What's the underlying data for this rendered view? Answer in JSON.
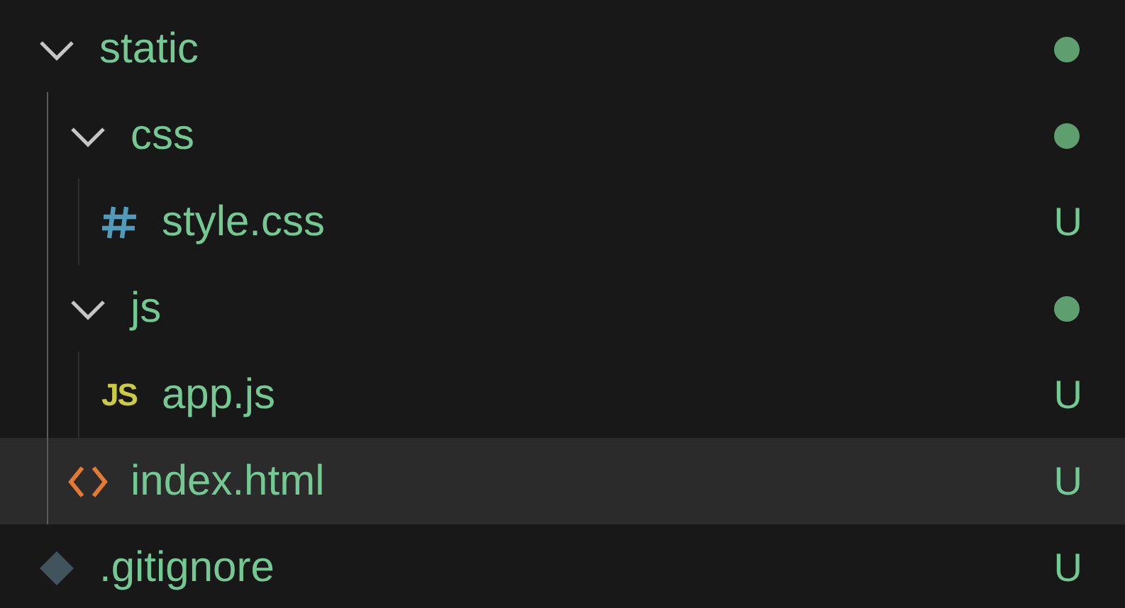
{
  "explorer": {
    "items": [
      {
        "name": "static",
        "kind": "folder",
        "expanded": true,
        "selected": false,
        "has_dot": true,
        "children": [
          {
            "name": "css",
            "kind": "folder",
            "expanded": true,
            "selected": false,
            "has_dot": true,
            "children": [
              {
                "name": "style.css",
                "kind": "css",
                "selected": false,
                "badge": "U"
              }
            ]
          },
          {
            "name": "js",
            "kind": "folder",
            "expanded": true,
            "selected": false,
            "has_dot": true,
            "children": [
              {
                "name": "app.js",
                "kind": "js",
                "icon_label": "JS",
                "selected": false,
                "badge": "U"
              }
            ]
          },
          {
            "name": "index.html",
            "kind": "html",
            "selected": true,
            "badge": "U"
          }
        ]
      },
      {
        "name": ".gitignore",
        "kind": "git",
        "selected": false,
        "badge": "U"
      }
    ]
  }
}
